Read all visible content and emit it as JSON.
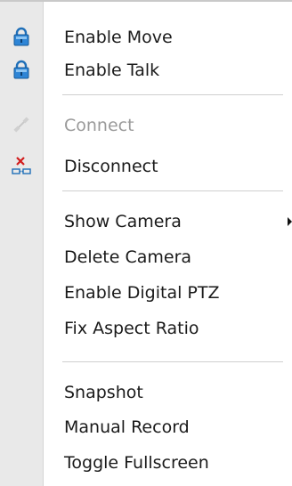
{
  "menu": {
    "items": [
      {
        "label": "Enable Move",
        "icon": "lock-icon",
        "enabled": true
      },
      {
        "label": "Enable Talk",
        "icon": "lock-icon",
        "enabled": true
      },
      {
        "label": "Connect",
        "icon": "connect-icon",
        "enabled": false
      },
      {
        "label": "Disconnect",
        "icon": "disconnect-icon",
        "enabled": true
      },
      {
        "label": "Show Camera",
        "icon": "",
        "enabled": true,
        "submenu": true
      },
      {
        "label": "Delete Camera",
        "icon": "",
        "enabled": true
      },
      {
        "label": "Enable Digital PTZ",
        "icon": "",
        "enabled": true
      },
      {
        "label": "Fix Aspect Ratio",
        "icon": "",
        "enabled": true
      },
      {
        "label": "Snapshot",
        "icon": "",
        "enabled": true
      },
      {
        "label": "Manual Record",
        "icon": "",
        "enabled": true
      },
      {
        "label": "Toggle Fullscreen",
        "icon": "",
        "enabled": true
      }
    ]
  },
  "colors": {
    "lock_icon": "#1f6fb8",
    "disconnect_icon": "#d21c1c",
    "disabled_text": "#9a9a9a",
    "gutter": "#e9e9e9"
  }
}
